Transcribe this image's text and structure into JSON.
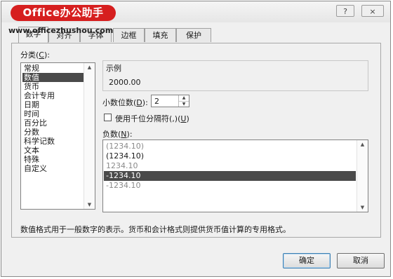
{
  "watermark": {
    "logo": "Office办公助手",
    "url": "www.officezhushou.com"
  },
  "titlebar": {
    "help": "?",
    "close": "×"
  },
  "tabs": [
    {
      "label": "数字"
    },
    {
      "label": "对齐"
    },
    {
      "label": "字体"
    },
    {
      "label": "边框"
    },
    {
      "label": "填充"
    },
    {
      "label": "保护"
    }
  ],
  "category": {
    "label_prefix": "分类(",
    "label_key": "C",
    "label_suffix": "):",
    "items": [
      "常规",
      "数值",
      "货币",
      "会计专用",
      "日期",
      "时间",
      "百分比",
      "分数",
      "科学记数",
      "文本",
      "特殊",
      "自定义"
    ],
    "selected": "数值"
  },
  "sample": {
    "label": "示例",
    "value": "2000.00"
  },
  "decimal": {
    "label_prefix": "小数位数(",
    "label_key": "D",
    "label_suffix": "):",
    "value": "2"
  },
  "separator": {
    "label_prefix": "使用千位分隔符(,)(",
    "label_key": "U",
    "label_suffix": ")",
    "checked": false
  },
  "negative": {
    "label_prefix": "负数(",
    "label_key": "N",
    "label_suffix": "):",
    "items": [
      "(1234.10)",
      "(1234.10)",
      "1234.10",
      "-1234.10",
      "-1234.10"
    ],
    "selected_index": 3
  },
  "description": "数值格式用于一般数字的表示。货币和会计格式则提供货币值计算的专用格式。",
  "buttons": {
    "ok": "确定",
    "cancel": "取消"
  }
}
